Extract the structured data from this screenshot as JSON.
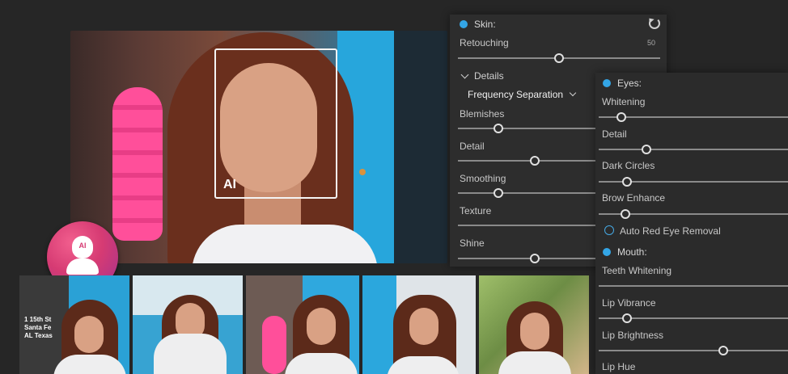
{
  "main_photo": {
    "ai_label": "AI"
  },
  "skin": {
    "title": "Skin:",
    "retouching": {
      "label": "Retouching",
      "value": "50",
      "level": 0.5
    },
    "details_label": "Details",
    "method": "Frequency Separation",
    "sliders": [
      {
        "label": "Blemishes",
        "level": 0.2
      },
      {
        "label": "Detail",
        "level": 0.38
      },
      {
        "label": "Smoothing",
        "level": 0.2
      },
      {
        "label": "Texture"
      },
      {
        "label": "Shine",
        "level": 0.38
      }
    ]
  },
  "eyes": {
    "title": "Eyes:",
    "sliders": [
      {
        "label": "Whitening",
        "level": 0.12
      },
      {
        "label": "Detail",
        "level": 0.25
      },
      {
        "label": "Dark Circles",
        "level": 0.15
      },
      {
        "label": "Brow Enhance",
        "level": 0.14
      }
    ],
    "auto_red_eye": "Auto Red Eye Removal"
  },
  "mouth": {
    "title": "Mouth:",
    "sliders": [
      {
        "label": "Teeth Whitening"
      },
      {
        "label": "Lip Vibrance",
        "level": 0.15
      },
      {
        "label": "Lip Brightness",
        "level": 0.66
      },
      {
        "label": "Lip Hue"
      }
    ]
  },
  "colors": {
    "accent": "#33a5e6",
    "badge": "#d63b73"
  },
  "thumbnail_sign": "1 15th St Santa Fe AL Texas"
}
